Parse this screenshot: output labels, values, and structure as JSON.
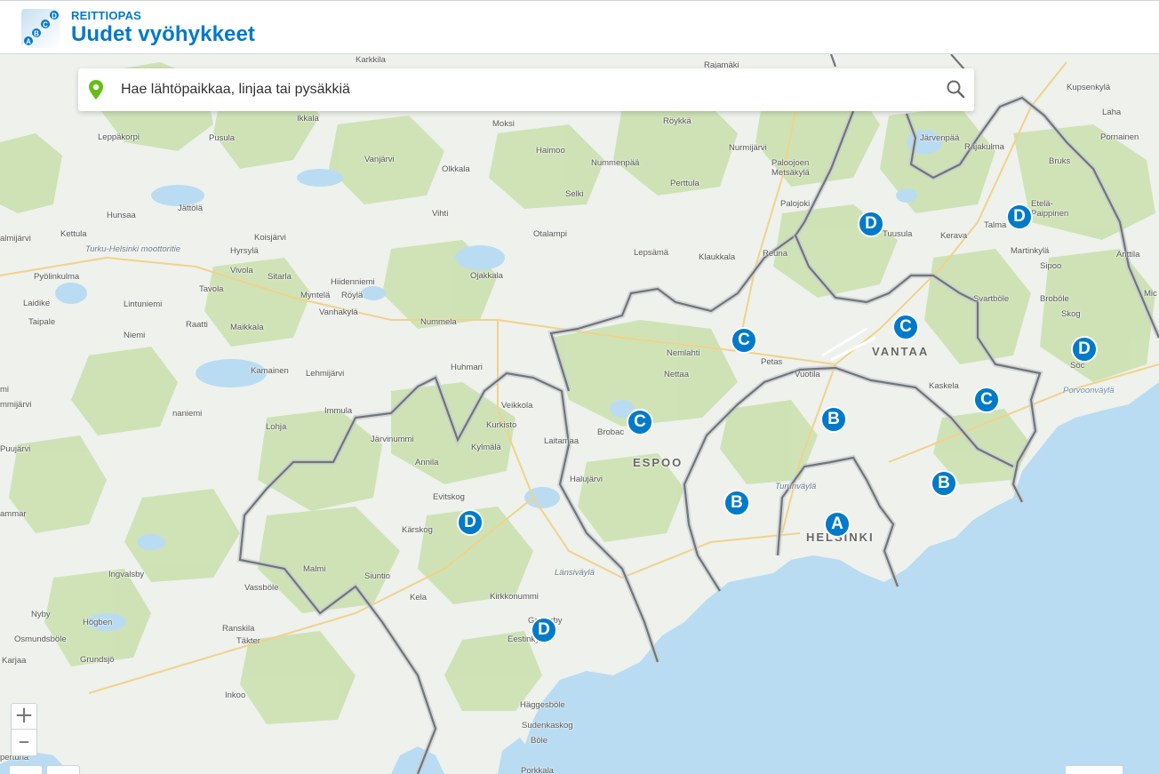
{
  "header": {
    "brand_sub": "REITTIOPAS",
    "title": "Uudet vyöhykkeet",
    "logo_letters": [
      "A",
      "B",
      "C",
      "D"
    ]
  },
  "search": {
    "placeholder": "Hae lähtöpaikkaa, linjaa tai pysäkkiä",
    "pin_icon": "location-pin-icon",
    "search_icon": "magnifier-icon"
  },
  "zoom": {
    "in_label": "+",
    "out_label": "–"
  },
  "colors": {
    "brand_blue": "#007ac9",
    "pin_green": "#64be14",
    "sea": "#b9dcf2",
    "land": "#eef1ec",
    "forest": "#cde2b4",
    "zone_border": "#7a7f84"
  },
  "cities": [
    "VANTAA",
    "ESPOO",
    "HELSINKI"
  ],
  "zones": [
    {
      "letter": "A"
    },
    {
      "letter": "B"
    },
    {
      "letter": "B"
    },
    {
      "letter": "B"
    },
    {
      "letter": "C"
    },
    {
      "letter": "C"
    },
    {
      "letter": "C"
    },
    {
      "letter": "C"
    },
    {
      "letter": "D"
    },
    {
      "letter": "D"
    },
    {
      "letter": "D"
    },
    {
      "letter": "D"
    },
    {
      "letter": "D"
    }
  ],
  "places": [
    "Karkkila",
    "Rajamäki",
    "Kupsenkylä",
    "Ikkala",
    "Moksi",
    "Röykkä",
    "Laha",
    "Leppäkorpi",
    "Pusula",
    "Järvenpää",
    "Rajakulma",
    "Pornainen",
    "Haimoo",
    "Nurmijärvi",
    "Vanjärvi",
    "Olkkala",
    "Nummenpää",
    "Paloojoen Metsäkylä",
    "Bruks",
    "Hunsaa",
    "Jättölä",
    "Vihti",
    "Selki",
    "Perttula",
    "Palojoki",
    "Etelä-Paippinen",
    "Kettula",
    "Otalampi",
    "Tuusula",
    "Talma",
    "almijärvi",
    "Koisjärvi",
    "Kerava",
    "Turku-Helsinki moottoritie",
    "Hyrsylä",
    "Lepsämä",
    "Klaukkala",
    "Reuna",
    "Martinkylä",
    "Anttila",
    "Pyölinkulma",
    "Vivola",
    "Sitarla",
    "Ojakkala",
    "Sipoo",
    "Tavola",
    "Hiidenniemi",
    "Laidike",
    "Lintuniemi",
    "Myntelä",
    "Röylä",
    "Vanhakylä",
    "Svartböle",
    "Broböle",
    "Mic",
    "Taipale",
    "Raatti",
    "Nummela",
    "Skog",
    "Niemi",
    "Maikkala",
    "Nemlahti",
    "Petas",
    "Kamainen",
    "Lehmijärvi",
    "Huhmari",
    "Nettaa",
    "Vuotila",
    "Söc",
    "Kaskela",
    "Porvoonväylä",
    "mi",
    "mmijärvi",
    "Immula",
    "Veikkola",
    "naniemi",
    "Lohja",
    "Kurkisto",
    "Brobac",
    "Järvinummi",
    "Laitamaa",
    "Kylmälä",
    "Puujärvi",
    "Annila",
    "Halujärvi",
    "Evitskog",
    "Turunväylä",
    "ammar",
    "Kärskog",
    "Malmi",
    "Länsiväylä",
    "Ingvalsby",
    "Vassböle",
    "Siuntio",
    "Kela",
    "Kirkkonummi",
    "Nyby",
    "Högben",
    "Gesterby",
    "Osmundsböle",
    "Ranskila",
    "Täkter",
    "Eestinkylä",
    "Karjaa",
    "Grundsjö",
    "Inkoo",
    "Häggesböle",
    "Sudenkaskog",
    "Böle",
    "pertuna",
    "Porkkala"
  ]
}
